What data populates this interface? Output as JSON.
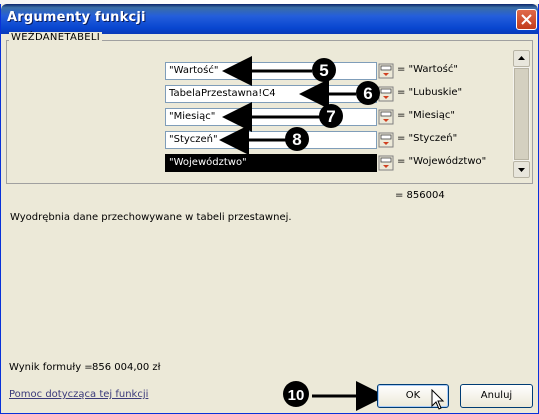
{
  "window": {
    "title": "Argumenty funkcji"
  },
  "group": {
    "legend": "WEŹDANETABELI"
  },
  "arguments": [
    {
      "value": "\"Wartość\"",
      "result": "= \"Wartość\"",
      "selected": false
    },
    {
      "value": "TabelaPrzestawna!C4",
      "result": "= \"Lubuskie\"",
      "selected": false
    },
    {
      "value": "\"Miesiąc\"",
      "result": "= \"Miesiąc\"",
      "selected": false
    },
    {
      "value": "\"Styczeń\"",
      "result": "= \"Styczeń\"",
      "selected": false
    },
    {
      "value": "\"Województwo\"",
      "result": "= \"Województwo\"",
      "selected": true
    }
  ],
  "callouts": [
    "5",
    "6",
    "7",
    "8",
    "10"
  ],
  "total_result": "= 856004",
  "description": "Wyodrębnia dane przechowywane w tabeli przestawnej.",
  "formula": {
    "label": "Wynik formuły =",
    "value": "856 004,00 zł"
  },
  "help_link": "Pomoc dotycząca tej funkcji",
  "buttons": {
    "ok": "OK",
    "cancel": "Anuluj"
  }
}
